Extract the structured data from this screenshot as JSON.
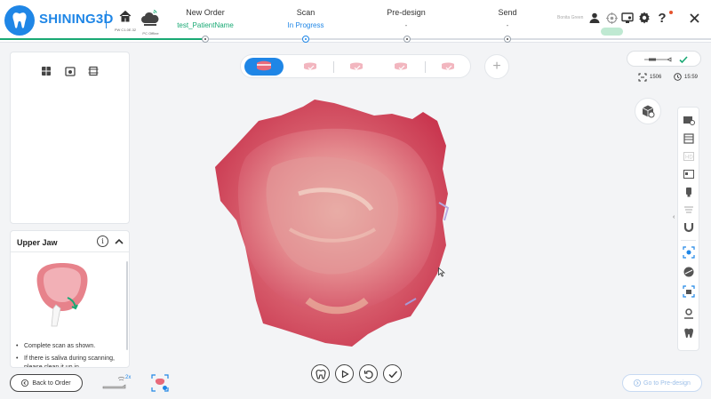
{
  "app": {
    "brand": "SHINING3D",
    "home_caption": "PW C1.0E.32",
    "cloud_caption": "PC Offline",
    "user_name": "Bonita Green"
  },
  "steps": [
    {
      "title": "New Order",
      "sub": "test_PatientName",
      "status": "done"
    },
    {
      "title": "Scan",
      "sub": "In Progress",
      "status": "active"
    },
    {
      "title": "Pre-design",
      "sub": "-",
      "status": "pending"
    },
    {
      "title": "Send",
      "sub": "-",
      "status": "pending"
    }
  ],
  "progress_percent": 29,
  "left_panel": {
    "jaw_title": "Upper Jaw",
    "info_symbol": "i",
    "tips": [
      "Complete scan as shown.",
      "If there is saliva during scanning, please clean it up in"
    ]
  },
  "bottom": {
    "back_label": "Back to Order",
    "zoom_label": "2x",
    "pre_design_label": "Go to Pre-design"
  },
  "toolbar": {
    "add_symbol": "+"
  },
  "stats": {
    "count": "1506",
    "time": "15:59"
  },
  "colors": {
    "accent": "#1f86e6",
    "success": "#19a974",
    "scan_tissue": "#d94a5e"
  },
  "icons": [
    "home-icon",
    "cloud-icon",
    "user-icon",
    "target-icon",
    "monitor-icon",
    "gear-icon",
    "help-icon",
    "close-icon",
    "check-icon",
    "clock-icon"
  ]
}
